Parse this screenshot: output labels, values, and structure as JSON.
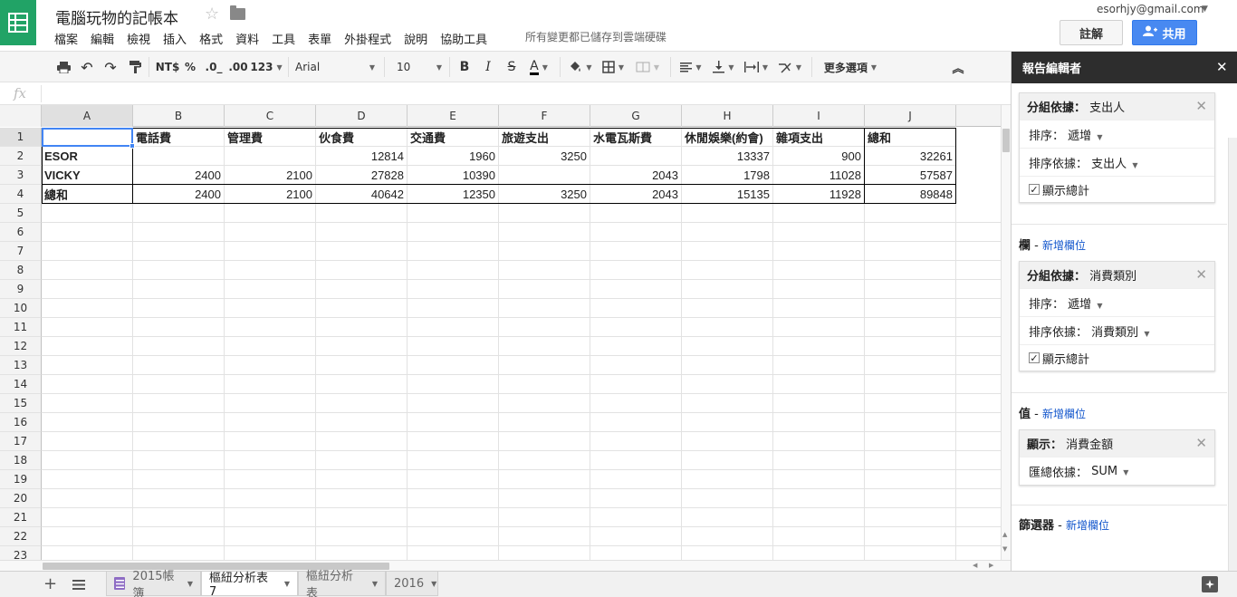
{
  "header": {
    "doc_title": "電腦玩物的記帳本",
    "menus": [
      "檔案",
      "編輯",
      "檢視",
      "插入",
      "格式",
      "資料",
      "工具",
      "表單",
      "外掛程式",
      "說明",
      "協助工具"
    ],
    "save_status": "所有變更都已儲存到雲端硬碟",
    "account": "esorhjy@gmail.com",
    "comments_label": "註解",
    "share_label": "共用",
    "brand_color": "#21a366",
    "share_color": "#4889f1"
  },
  "toolbar": {
    "currency": "NT$",
    "percent": "%",
    "dec_decrease": ".0_",
    "dec_increase": ".00",
    "number_format": "123",
    "font": "Arial",
    "font_size": "10",
    "bold": "B",
    "italic": "I",
    "strike": "S",
    "text_color": "A",
    "more": "更多選項"
  },
  "formula": {
    "fx": "fx",
    "value": ""
  },
  "grid": {
    "columns": [
      "A",
      "B",
      "C",
      "D",
      "E",
      "F",
      "G",
      "H",
      "I",
      "J"
    ],
    "row_numbers": [
      "1",
      "2",
      "3",
      "4",
      "5",
      "6",
      "7",
      "8",
      "9",
      "10",
      "11",
      "12",
      "13",
      "14",
      "15",
      "16",
      "17",
      "18",
      "19",
      "20",
      "21",
      "22",
      "23"
    ],
    "rows": [
      [
        "",
        "電話費",
        "管理費",
        "伙食費",
        "交通費",
        "旅遊支出",
        "水電瓦斯費",
        "休閒娛樂(約會)",
        "雜項支出",
        "總和"
      ],
      [
        "ESOR",
        "",
        "",
        "12814",
        "1960",
        "3250",
        "",
        "13337",
        "900",
        "32261"
      ],
      [
        "VICKY",
        "2400",
        "2100",
        "27828",
        "10390",
        "",
        "2043",
        "1798",
        "11028",
        "57587"
      ],
      [
        "總和",
        "2400",
        "2100",
        "40642",
        "12350",
        "3250",
        "2043",
        "15135",
        "11928",
        "89848"
      ]
    ]
  },
  "sheets": {
    "tabs": [
      "2015帳簿",
      "樞紐分析表 7",
      "樞紐分析表",
      "2016"
    ],
    "active": 1
  },
  "panel": {
    "title": "報告編輯者",
    "rows_group": {
      "head_label": "分組依據：",
      "head_value": "支出人",
      "sort_label": "排序：",
      "sort_value": "遞增",
      "sortby_label": "排序依據：",
      "sortby_value": "支出人",
      "totals_label": "顯示總計"
    },
    "columns_section": "欄",
    "add_field": "新增欄位",
    "cols_group": {
      "head_label": "分組依據：",
      "head_value": "消費類別",
      "sort_label": "排序：",
      "sort_value": "遞增",
      "sortby_label": "排序依據：",
      "sortby_value": "消費類別",
      "totals_label": "顯示總計"
    },
    "values_section": "值",
    "values_card": {
      "head_label": "顯示：",
      "head_value": "消費金額",
      "summarize_label": "匯總依據：",
      "summarize_value": "SUM"
    },
    "filters_section": "篩選器"
  }
}
